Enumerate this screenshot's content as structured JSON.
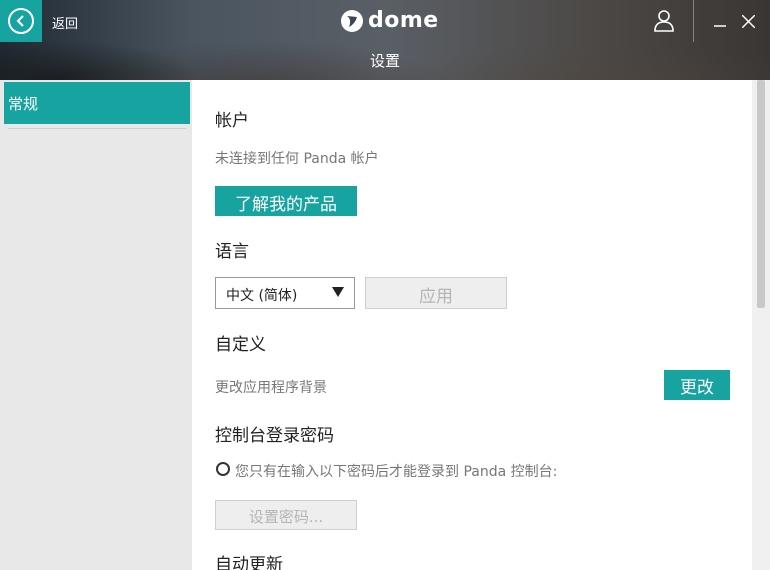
{
  "header": {
    "back_label": "返回",
    "logo_text": "dome",
    "page_title": "设置"
  },
  "sidebar": {
    "items": [
      {
        "label": "常规",
        "active": true
      }
    ]
  },
  "account": {
    "title": "帐户",
    "status": "未连接到任何 Panda 帐户",
    "learn_button": "了解我的产品"
  },
  "language": {
    "title": "语言",
    "selected": "中文 (简体)",
    "apply_button": "应用"
  },
  "customize": {
    "title": "自定义",
    "description": "更改应用程序背景",
    "change_button": "更改"
  },
  "console_password": {
    "title": "控制台登录密码",
    "option_label": "您只有在输入以下密码后才能登录到 Panda 控制台:",
    "set_button": "设置密码..."
  },
  "auto_update": {
    "title": "自动更新"
  },
  "colors": {
    "accent": "#17a3a0",
    "sidebar_bg": "#e8e8e8"
  }
}
